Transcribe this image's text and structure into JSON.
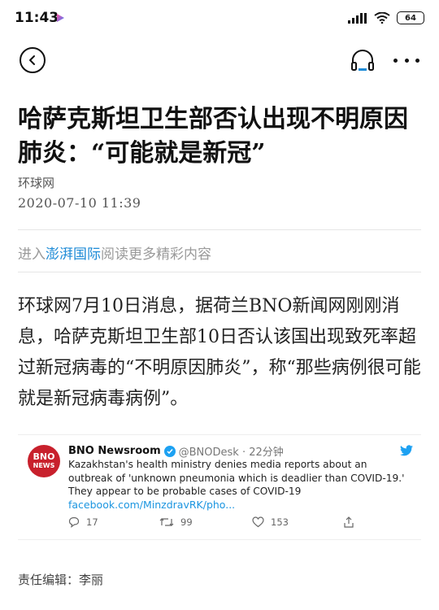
{
  "status_bar": {
    "time": "11:43",
    "battery": "64"
  },
  "article": {
    "title": "哈萨克斯坦卫生部否认出现不明原因肺炎：“可能就是新冠”",
    "source": "环球网",
    "datetime": "2020-07-10  11:39",
    "promo_prefix": "进入",
    "promo_brand": "澎湃国际",
    "promo_suffix": "阅读更多精彩内容",
    "body": "环球网7月10日消息，据荷兰BNO新闻网刚刚消息，哈萨克斯坦卫生部10日否认该国出现致死率超过新冠病毒的“不明原因肺炎”，称“那些病例很可能就是新冠病毒病例”。",
    "editor": "责任编辑：李丽"
  },
  "tweet": {
    "avatar_line1": "BNO",
    "avatar_line2": "NEWS",
    "name": "BNO Newsroom",
    "handle": "@BNODesk · 22分钟",
    "text": "Kazakhstan's health ministry denies media reports about an outbreak of 'unknown pneumonia which is deadlier than COVID-19.' They appear to be probable cases of COVID-19",
    "link": "facebook.com/MinzdravRK/pho...",
    "replies": "17",
    "retweets": "99",
    "likes": "153"
  },
  "colors": {
    "accent_link": "#1c8ad6",
    "twitter_blue": "#1da1f2",
    "bno_red": "#c8202c"
  }
}
